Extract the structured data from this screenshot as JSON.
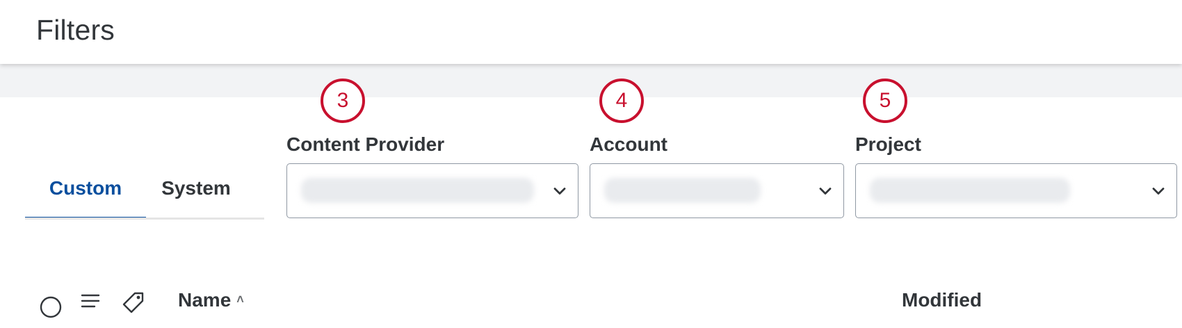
{
  "header": {
    "title": "Filters"
  },
  "tabs": [
    {
      "label": "Custom",
      "active": true
    },
    {
      "label": "System",
      "active": false
    }
  ],
  "callouts": [
    "3",
    "4",
    "5"
  ],
  "filters": [
    {
      "label": "Content Provider",
      "value": "",
      "icon": "chevron-down-icon"
    },
    {
      "label": "Account",
      "value": "",
      "icon": "chevron-down-icon"
    },
    {
      "label": "Project",
      "value": "",
      "icon": "chevron-down-icon"
    }
  ],
  "list_header": {
    "icons": [
      "select-all-circle-icon",
      "list-icon",
      "tag-icon"
    ],
    "name_column": "Name",
    "name_sort_indicator": "˄",
    "modified_column": "Modified"
  },
  "colors": {
    "accent": "#0a4f9e",
    "callout": "#c8102e",
    "strip": "#f2f3f5"
  }
}
